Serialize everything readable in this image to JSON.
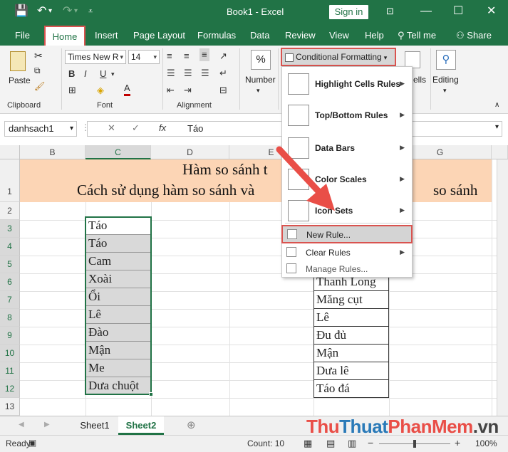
{
  "titlebar": {
    "title": "Book1 - Excel",
    "signin": "Sign in",
    "save_icon": "save-icon",
    "undo_icon": "undo-icon",
    "redo_icon": "redo-icon"
  },
  "tabs": [
    "File",
    "Home",
    "Insert",
    "Page Layout",
    "Formulas",
    "Data",
    "Review",
    "View",
    "Help"
  ],
  "tellme": "Tell me",
  "share": "Share",
  "ribbon": {
    "paste": "Paste",
    "clipboard": "Clipboard",
    "font_name": "Times New R",
    "font_size": "14",
    "font_group": "Font",
    "alignment_group": "Alignment",
    "number": "Number",
    "number_symbol": "%",
    "conditional_formatting": "Conditional Formatting",
    "cells_partial": "ells",
    "editing": "Editing",
    "bold": "B",
    "italic": "I",
    "underline": "U",
    "font_color_letter": "A"
  },
  "formula": {
    "namebox": "danhsach1",
    "value": "Táo",
    "fx": "fx",
    "cancel": "✕",
    "enter": "✓"
  },
  "columns": [
    "B",
    "C",
    "D",
    "E",
    "G"
  ],
  "rows": [
    "1",
    "2",
    "3",
    "4",
    "5",
    "6",
    "7",
    "8",
    "9",
    "10",
    "11",
    "12",
    "13"
  ],
  "sheet": {
    "title_line1_left": "Hàm so sánh t",
    "title_line2_left": "Cách sử dụng hàm so sánh và",
    "title_line2_right": "so sánh",
    "col_c": [
      "Táo",
      "Táo",
      "Cam",
      "Xoài",
      "Ổi",
      "Lê",
      "Đào",
      "Mận",
      "Me",
      "Dưa chuột"
    ],
    "col_f": [
      "Thanh Long",
      "Măng cụt",
      "Lê",
      "Đu đủ",
      "Mận",
      "Dưa lê",
      "Táo đá"
    ]
  },
  "menu": {
    "highlight": "Highlight Cells Rules",
    "topbottom": "Top/Bottom Rules",
    "databars": "Data Bars",
    "colorscales": "Color Scales",
    "iconsets": "Icon Sets",
    "newrule": "New Rule...",
    "clearrules": "Clear Rules",
    "managerules": "Manage Rules..."
  },
  "sheets": [
    "Sheet1",
    "Sheet2"
  ],
  "status": {
    "ready": "Ready",
    "count": "Count: 10",
    "zoom": "100%"
  },
  "watermark": {
    "part1": "Thu",
    "part2": "Thuat",
    "part3": "PhanMem",
    "part4": ".vn"
  },
  "colors": {
    "excel_green": "#217346",
    "highlight_red": "#d9534f",
    "title_band": "#fcd5b5",
    "arrow": "#e94e47"
  }
}
